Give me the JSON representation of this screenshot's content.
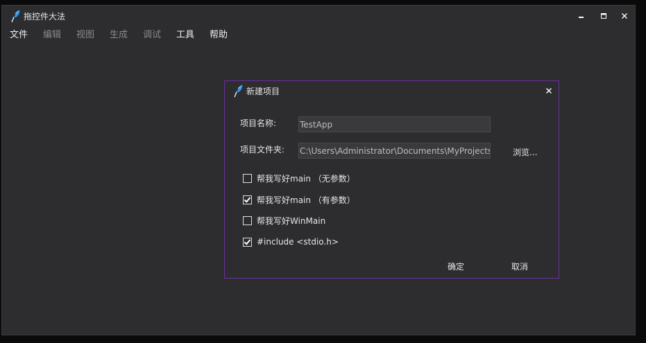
{
  "app": {
    "title": "拖控件大法",
    "icon": "feather-pen-icon",
    "accent_color": "#1e9fff"
  },
  "menu": {
    "items": [
      {
        "label": "文件",
        "enabled": true
      },
      {
        "label": "编辑",
        "enabled": false
      },
      {
        "label": "视图",
        "enabled": false
      },
      {
        "label": "生成",
        "enabled": false
      },
      {
        "label": "调试",
        "enabled": false
      },
      {
        "label": "工具",
        "enabled": true
      },
      {
        "label": "帮助",
        "enabled": true
      }
    ]
  },
  "dialog": {
    "title": "新建项目",
    "border_color": "#6b2fa0",
    "project_name_label": "项目名称:",
    "project_name_value": "TestApp",
    "project_folder_label": "项目文件夹:",
    "project_folder_value": "C:\\Users\\Administrator\\Documents\\MyProjects\\TestApp",
    "browse_label": "浏览...",
    "options": [
      {
        "label": "帮我写好main （无参数）",
        "checked": false
      },
      {
        "label": "帮我写好main （有参数）",
        "checked": true
      },
      {
        "label": "帮我写好WinMain",
        "checked": false
      },
      {
        "label": "#include <stdio.h>",
        "checked": true
      }
    ],
    "ok_label": "确定",
    "cancel_label": "取消"
  }
}
